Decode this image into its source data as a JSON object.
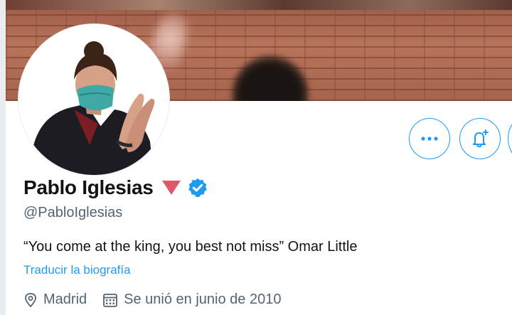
{
  "profile": {
    "display_name": "Pablo Iglesias",
    "handle": "@PabloIglesias",
    "bio": "“You come at the king, you best not miss” Omar Little",
    "translate_link": "Traducir la biografía",
    "location": "Madrid",
    "joined": "Se unió en junio de 2010"
  },
  "icons": {
    "more": "more-icon",
    "notifications": "bell-plus-icon",
    "verified": "verified-badge-icon",
    "location": "location-pin-icon",
    "calendar": "calendar-icon",
    "party": "red-triangle-icon"
  },
  "colors": {
    "accent": "#1d9bf0",
    "text": "#0f1419",
    "secondary_text": "#536471",
    "triangle": "#e0566b"
  }
}
